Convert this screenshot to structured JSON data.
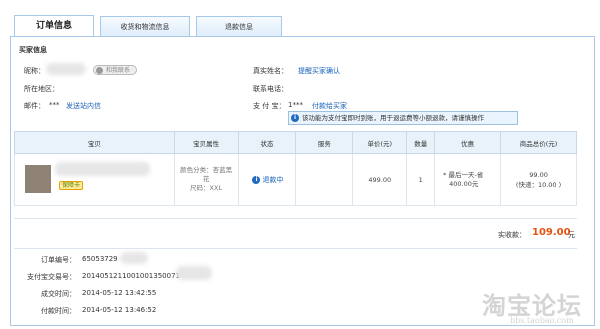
{
  "tabs": [
    {
      "label": "订单信息",
      "active": true
    },
    {
      "label": "收货和物流信息",
      "active": false
    },
    {
      "label": "退款信息",
      "active": false
    }
  ],
  "seller": {
    "section_title": "买家信息",
    "nickname_label": "昵称：",
    "chat_label": "和我联系",
    "region_label": "所在地区：",
    "email_label": "邮件：",
    "email_value": "***",
    "email_link": "发送站内信",
    "realname_label": "真实姓名：",
    "realname_link": "提醒买家确认",
    "phone_label": "联系电话：",
    "alipay_label": "支 付 宝：",
    "alipay_value": "1***",
    "alipay_link": "付款给买家",
    "tip": "该功能为支付宝即时到账，用于退运费等小额退款，请谨慎操作"
  },
  "order_table": {
    "headers": [
      "宝贝",
      "宝贝属性",
      "状态",
      "服务",
      "单价(元)",
      "数量",
      "优惠",
      "商品总价(元)"
    ],
    "row": {
      "badge": "保障卡",
      "attr_color": "颜色分类：杏蓝黑花",
      "attr_size": "尺码：XXL",
      "status": "退款中",
      "service": "",
      "unit_price": "499.00",
      "quantity": "1",
      "discount_line1": "* 最后一天-省",
      "discount_line2": "400.00元",
      "total": "99.00",
      "shipping": "(快递：10.00 )"
    }
  },
  "summary": {
    "paid_label": "实收款：",
    "paid_amount": "109.00",
    "paid_unit": "元"
  },
  "details": {
    "order_no_label": "订单编号：",
    "order_no": "65053729",
    "alipay_no_label": "支付宝交易号：",
    "alipay_no": "2014051211001001350071",
    "deal_time_label": "成交时间：",
    "deal_time": "2014-05-12 13:42:55",
    "pay_time_label": "付款时间：",
    "pay_time": "2014-05-12 13:46:52"
  },
  "watermark": {
    "brand": "淘宝论坛",
    "url": "bbs.taobao.com"
  },
  "colors": {
    "accent_blue": "#1a62b8",
    "price_orange": "#e4520e",
    "border_blue": "#a8c8e8",
    "header_bg": "#e9f2fb"
  }
}
